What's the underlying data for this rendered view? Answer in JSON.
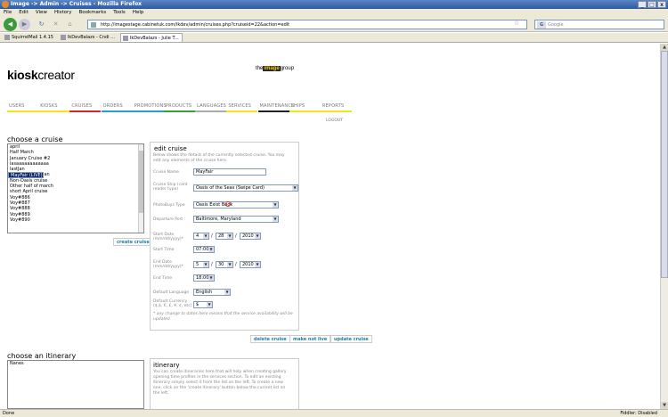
{
  "window": {
    "title": "Image -> Admin -> Cruises - Mozilla Firefox",
    "controls": [
      "_",
      "□",
      "x"
    ]
  },
  "menu": [
    "File",
    "Edit",
    "View",
    "History",
    "Bookmarks",
    "Tools",
    "Help"
  ],
  "nav": {
    "url": "http://imagestage.cabinetuk.com/ikdev/admin/cruises.php?cruiseid=22&action=edit",
    "search_placeholder": "Google",
    "search_engine": "G"
  },
  "tabs": [
    "SquirrelMail 1.4.15",
    "IkDevBalazs - Cndi ...",
    "IkDevBalazs - Julie T..."
  ],
  "status": {
    "left": "Done",
    "right": "Fiddler: Disabled"
  },
  "brand": {
    "kiosk": "kiosk",
    "creator": "creator",
    "pre": "the",
    "image": "image",
    "group": "group"
  },
  "menu_nav": [
    {
      "label": "USERS",
      "color": "#f3e41b"
    },
    {
      "label": "KIOSKS",
      "color": "#f3e41b"
    },
    {
      "label": "CRUISES",
      "color": "#d0282e"
    },
    {
      "label": "ORDERS",
      "color": "#29a0c6"
    },
    {
      "label": "PROMOTIONS",
      "color": "#29a0c6"
    },
    {
      "label": "PRODUCTS",
      "color": "#3a9e3a"
    },
    {
      "label": "LANGUAGES",
      "color": "#aaaaaa"
    },
    {
      "label": "SERVICES",
      "color": "#f3e41b"
    },
    {
      "label": "MAINTENANCE",
      "color": "#222222"
    },
    {
      "label": "SHIPS",
      "color": "#f3e41b"
    },
    {
      "label": "REPORTS",
      "color": "#f3e41b"
    }
  ],
  "logout": "LOGOUT",
  "choose_cruise": {
    "heading": "choose a cruise",
    "items": [
      "april",
      "Half March",
      "January Cruise #2",
      "lasaaaaaaaaaaaa",
      "lastJan",
      "MayFair (LIVE)",
      "new cruise for Jan",
      "Non-Oasis cruise",
      "Other half of march",
      "short April cruise",
      "Voy#886",
      "Voy#887",
      "Voy#888",
      "Voy#889",
      "Voy#890"
    ],
    "selected": "MayFair (LIVE)",
    "create_button": "create cruise"
  },
  "edit_cruise": {
    "heading": "edit cruise",
    "description": "Below shows the details of the currently selected cruise. You may edit any elements of the cruise here.",
    "fields": {
      "cruise_name_label": "Cruise Name",
      "cruise_name_value": "MayFair",
      "cruise_ship_label": "Cruise Ship (card reader type)",
      "cruise_ship_value": "Oasis of the Seas (Swipe Card)",
      "photobuys_label": "PhotoBuys Type",
      "photobuys_value": "Oasis Exist Book",
      "departure_label": "Departure Port",
      "departure_value": "Baltimore, Maryland",
      "start_date_label": "Start Date (mm/dd/yyyy)*",
      "start_month": "4",
      "start_day": "28",
      "start_year": "2010",
      "start_time_label": "Start Time",
      "start_time": "07:00",
      "end_date_label": "End Date (mm/dd/yyyy)*",
      "end_month": "5",
      "end_day": "30",
      "end_year": "2010",
      "end_time_label": "End Time",
      "end_time": "18:00",
      "language_label": "Default Language",
      "language_value": "English",
      "currency_label": "Default Currency ($,$, €, £, ¥, ¢, etc)",
      "currency_value": "$",
      "slash": "/"
    },
    "note": "* any change to dates here means that the service availability will be updated",
    "buttons": {
      "delete": "delete cruise",
      "make_not_live": "make not live",
      "update": "update cruise"
    }
  },
  "itinerary": {
    "heading": "choose an itinerary",
    "items": [
      "Nanes"
    ],
    "panel_heading": "itinerary",
    "panel_desc": "You can create itineraries here that will help when creating gallery opening time profiles in the services section. To edit an existing itinerary simply select it from the list on the left. To create a new one, click on the 'create itinerary' button below the current list on the left."
  }
}
